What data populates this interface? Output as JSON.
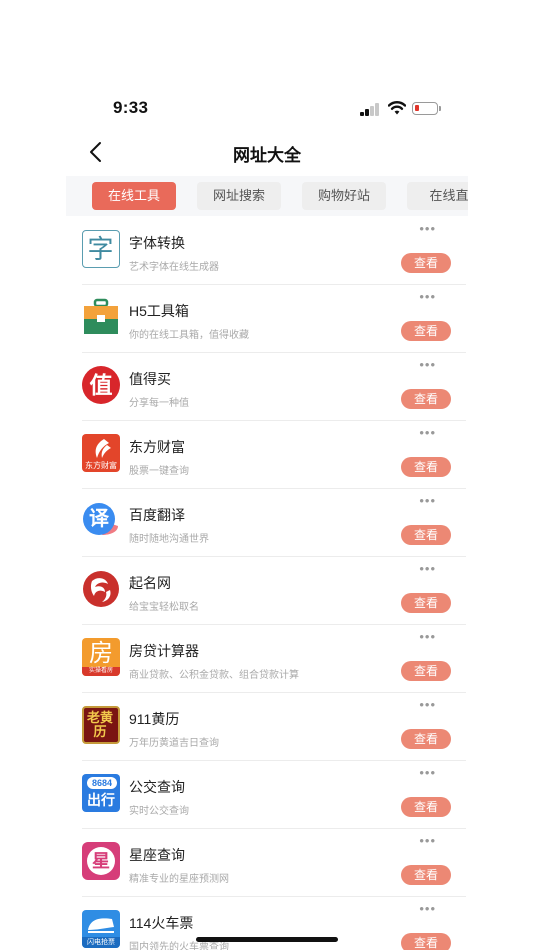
{
  "status_bar": {
    "time": "9:33"
  },
  "nav": {
    "title": "网址大全"
  },
  "tabs": [
    {
      "label": "在线工具",
      "active": true
    },
    {
      "label": "网址搜索",
      "active": false
    },
    {
      "label": "购物好站",
      "active": false
    },
    {
      "label": "在线直",
      "active": false
    }
  ],
  "list": {
    "more_label": "•••",
    "button_label": "查看",
    "items": [
      {
        "title": "字体转换",
        "desc": "艺术字体在线生成器",
        "icon": "font-convert-icon",
        "icon_text": "字"
      },
      {
        "title": "H5工具箱",
        "desc": "你的在线工具箱，值得收藏",
        "icon": "toolbox-icon",
        "icon_text": ""
      },
      {
        "title": "值得买",
        "desc": "分享每一种值",
        "icon": "smzdm-icon",
        "icon_text": "值"
      },
      {
        "title": "东方财富",
        "desc": "股票一键查询",
        "icon": "eastmoney-icon",
        "icon_text": "东方财富"
      },
      {
        "title": "百度翻译",
        "desc": "随时随地沟通世界",
        "icon": "baidu-translate-icon",
        "icon_text": "译"
      },
      {
        "title": "起名网",
        "desc": "给宝宝轻松取名",
        "icon": "naming-icon",
        "icon_text": ""
      },
      {
        "title": "房贷计算器",
        "desc": "商业贷款、公积金贷款、组合贷款计算",
        "icon": "mortgage-calculator-icon",
        "icon_text": "房",
        "icon_subtext": "实操看房"
      },
      {
        "title": "911黄历",
        "desc": "万年历黄道吉日查询",
        "icon": "almanac-icon",
        "icon_text": "老黄历"
      },
      {
        "title": "公交查询",
        "desc": "实时公交查询",
        "icon": "bus-icon",
        "icon_text": "出行",
        "icon_subtext": "8684"
      },
      {
        "title": "星座查询",
        "desc": "精准专业的星座预测网",
        "icon": "horoscope-icon",
        "icon_text": "星"
      },
      {
        "title": "114火车票",
        "desc": "国内领先的火车票查询",
        "icon": "train-ticket-icon",
        "icon_text": "闪电",
        "icon_subtext": "抢票"
      }
    ]
  },
  "colors": {
    "accent": "#e96a5a",
    "button": "#ec8874"
  }
}
